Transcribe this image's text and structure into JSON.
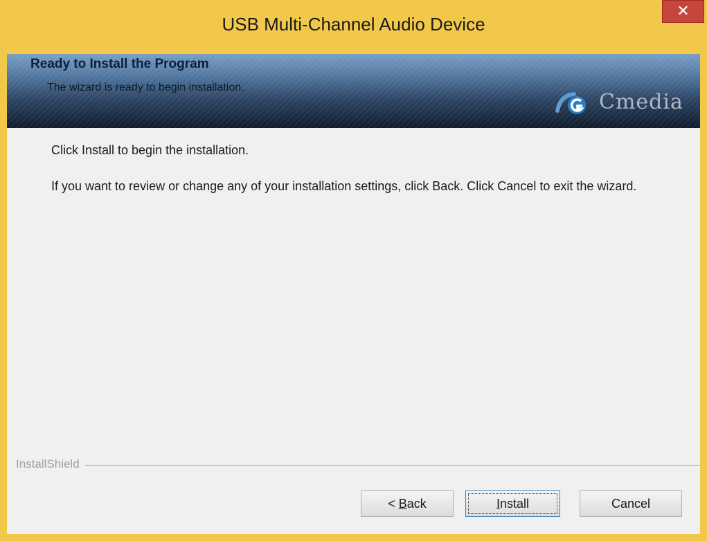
{
  "window": {
    "title": "USB Multi-Channel Audio Device",
    "close_glyph": "✕"
  },
  "banner": {
    "title": "Ready to Install the Program",
    "subtitle": "The wizard is ready to begin installation.",
    "logo_text": "Cmedia",
    "logo_icon": "cmedia-logo-icon"
  },
  "content": {
    "intro": "Click Install to begin the installation.",
    "review": "If you want to review or change any of your installation settings, click Back. Click Cancel to exit the wizard."
  },
  "footer": {
    "brand": "InstallShield"
  },
  "buttons": {
    "back_prefix": "< ",
    "back_mnemonic": "B",
    "back_rest": "ack",
    "install_mnemonic": "I",
    "install_rest": "nstall",
    "cancel": "Cancel"
  },
  "colors": {
    "titlebar": "#f1c84a",
    "close": "#c7463c",
    "client": "#f0f0f0",
    "banner_dark": "#101c2c",
    "focus_border": "#3c7fb1"
  }
}
